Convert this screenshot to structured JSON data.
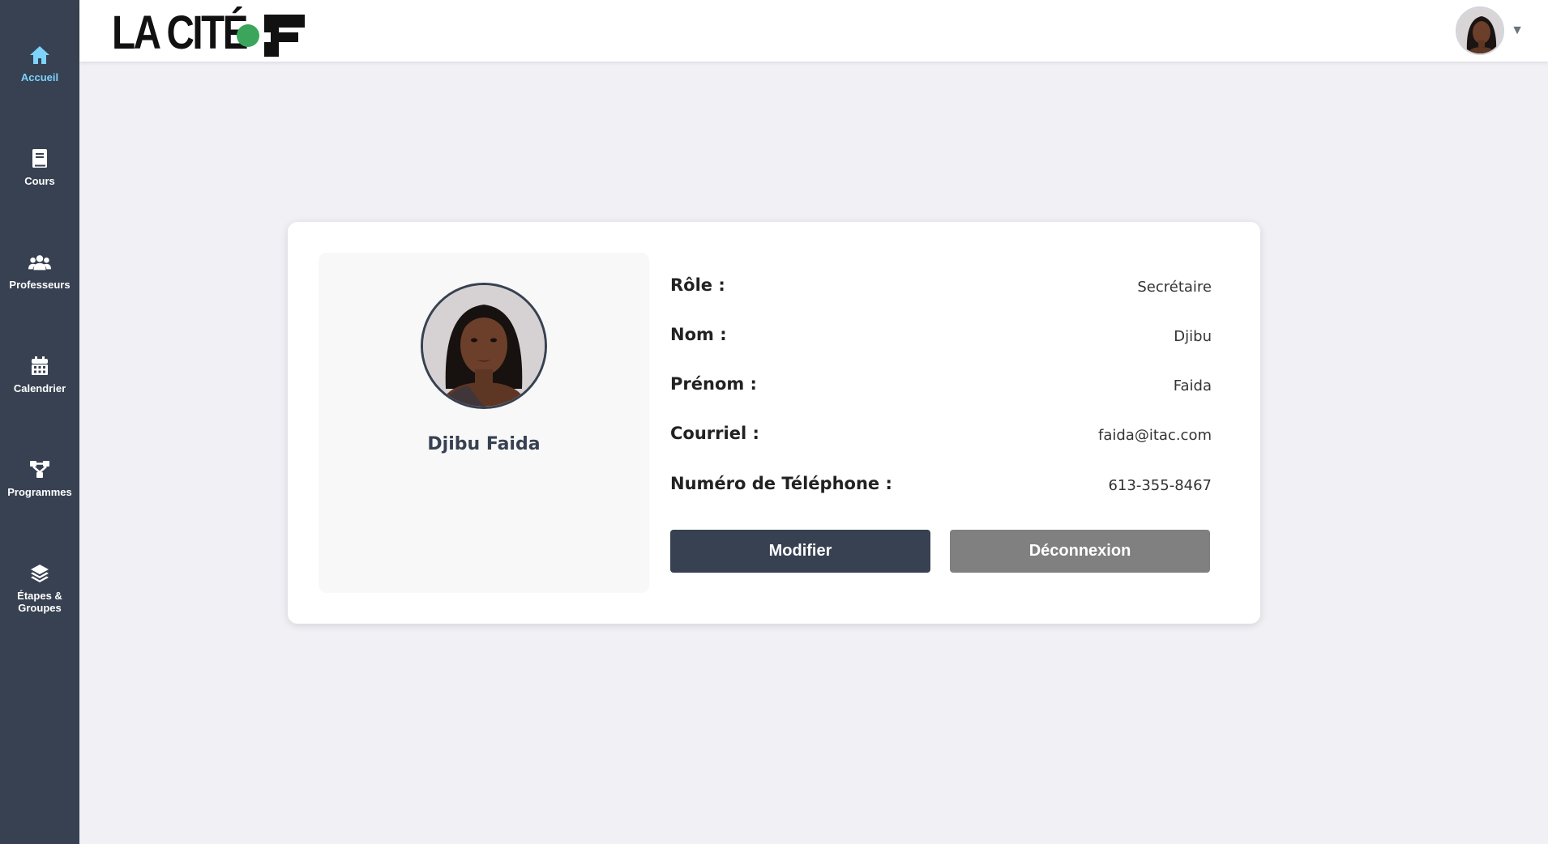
{
  "sidebar": {
    "items": [
      {
        "label": "Accueil",
        "icon": "home-icon",
        "active": true
      },
      {
        "label": "Cours",
        "icon": "book-icon"
      },
      {
        "label": "Professeurs",
        "icon": "users-icon"
      },
      {
        "label": "Calendrier",
        "icon": "calendar-icon"
      },
      {
        "label": "Programmes",
        "icon": "sitemap-icon"
      },
      {
        "label": "Étapes & Groupes",
        "icon": "layers-icon"
      }
    ]
  },
  "header": {
    "logo_text": "LA CITÉ",
    "user_menu_caret": "▼"
  },
  "profile": {
    "full_name": "Djibu Faida",
    "fields": [
      {
        "label": "Rôle :",
        "value": "Secrétaire"
      },
      {
        "label": "Nom :",
        "value": "Djibu"
      },
      {
        "label": "Prénom :",
        "value": "Faida"
      },
      {
        "label": "Courriel :",
        "value": "faida@itac.com"
      },
      {
        "label": "Numéro de Téléphone :",
        "value": "613-355-8467"
      }
    ],
    "edit_label": "Modifier",
    "logout_label": "Déconnexion"
  },
  "colors": {
    "sidebar_bg": "#374151",
    "active_nav": "#7dd3fc",
    "logo_green": "#3ba55c",
    "primary_button": "#374151",
    "secondary_button": "#808080"
  }
}
